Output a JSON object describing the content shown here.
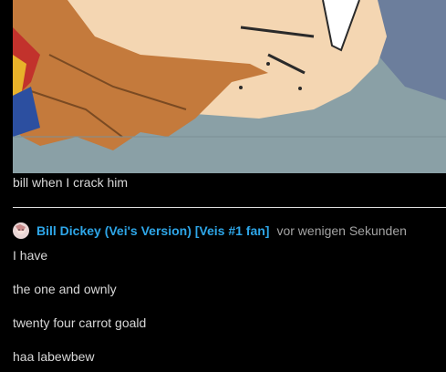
{
  "post": {
    "image_alt_icon": "cartoon-face-image",
    "caption": "bill when I crack him"
  },
  "comment": {
    "author": "Bill Dickey (Vei's Version) [Veis #1 fan]",
    "timestamp": "vor wenigen Sekunden",
    "lines": [
      "I have",
      "the one and ownly",
      "twenty four carrot goald",
      "haa labewbew"
    ]
  },
  "colors": {
    "background": "#000000",
    "author_link": "#2ea6e8",
    "text": "#d8d8d8",
    "timestamp": "#a3a3a3"
  }
}
